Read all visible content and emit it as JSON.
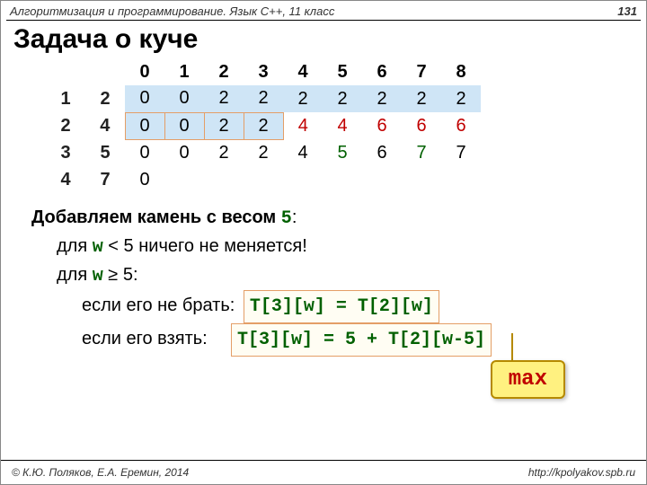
{
  "header": {
    "course": "Алгоритмизация и программирование. Язык C++, 11 класс",
    "page": "131"
  },
  "title": "Задача о куче",
  "table": {
    "cols": [
      "0",
      "1",
      "2",
      "3",
      "4",
      "5",
      "6",
      "7",
      "8"
    ],
    "rows": [
      {
        "i": "1",
        "wt": "2",
        "vals": [
          "0",
          "0",
          "2",
          "2",
          "2",
          "2",
          "2",
          "2",
          "2"
        ]
      },
      {
        "i": "2",
        "wt": "4",
        "vals": [
          "0",
          "0",
          "2",
          "2",
          "4",
          "4",
          "6",
          "6",
          "6"
        ]
      },
      {
        "i": "3",
        "wt": "5",
        "vals": [
          "0",
          "0",
          "2",
          "2",
          "4",
          "5",
          "6",
          "7",
          "7"
        ]
      },
      {
        "i": "4",
        "wt": "7",
        "vals": [
          "0",
          "",
          "",
          "",
          "",
          "",
          "",
          "",
          ""
        ]
      }
    ],
    "hl_cells_row2": [
      0,
      1,
      2,
      3
    ]
  },
  "text": {
    "l1a": "Добавляем камень с весом ",
    "l1b": "5",
    "l1c": ":",
    "l2a": "для ",
    "l2b": "w",
    "l2c": " < 5 ничего не меняется!",
    "l3a": "для ",
    "l3b": "w",
    "l3c": " ≥ 5:",
    "l4a": "если его не брать:",
    "l4b": "T[3][w] = T[2][w]",
    "l5a": "если его взять:",
    "l5b": "T[3][w] = 5 + T[2][w-5]"
  },
  "callout": "max",
  "footer": {
    "left": "© К.Ю. Поляков, Е.А. Еремин, 2014",
    "right": "http://kpolyakov.spb.ru"
  }
}
